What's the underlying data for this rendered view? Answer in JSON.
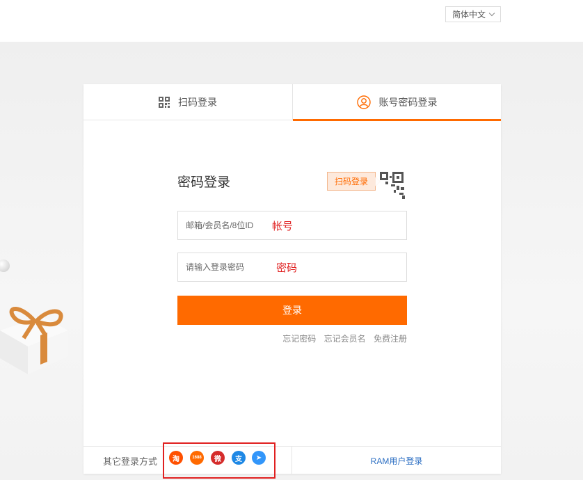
{
  "header": {
    "language": "简体中文"
  },
  "tabs": [
    {
      "label": "扫码登录"
    },
    {
      "label": "账号密码登录"
    }
  ],
  "form": {
    "title": "密码登录",
    "scan_tip": "扫码登录",
    "account_placeholder": "邮箱/会员名/8位ID",
    "account_annotation": "帐号",
    "password_placeholder": "请输入登录密码",
    "password_annotation": "密码",
    "login_label": "登录"
  },
  "links": {
    "forgot_password": "忘记密码",
    "forgot_member": "忘记会员名",
    "register": "免费注册"
  },
  "footer": {
    "other_methods": "其它登录方式",
    "ram": "RAM用户登录",
    "social_icons": [
      {
        "name": "taobao-icon",
        "glyph": "淘",
        "color": "#ff5000"
      },
      {
        "name": "1688-icon",
        "glyph": "1688",
        "color": "#ff6a00"
      },
      {
        "name": "weibo-icon",
        "glyph": "微",
        "color": "#d52c2b"
      },
      {
        "name": "alipay-icon",
        "glyph": "支",
        "color": "#1e88e5"
      },
      {
        "name": "dingtalk-icon",
        "glyph": "➤",
        "color": "#3296fa"
      }
    ]
  },
  "colors": {
    "accent": "#ff6a00",
    "link": "#2d6fc3",
    "annotation": "#e02020"
  }
}
